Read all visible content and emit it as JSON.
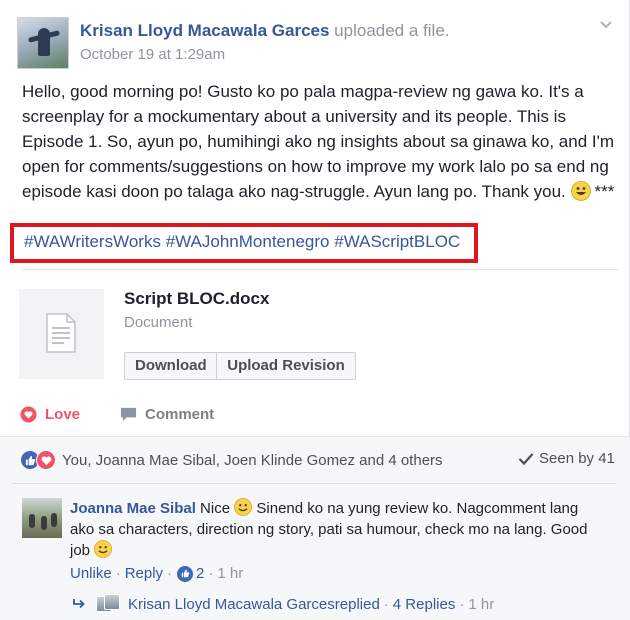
{
  "post": {
    "author": "Krisan Lloyd Macawala Garces",
    "action": " uploaded a file.",
    "timestamp": "October 19 at 1:29am",
    "text": "Hello, good morning po! Gusto ko po pala magpa-review ng gawa ko. It's a screenplay for a mockumentary about a university and its people. This is Episode 1. So, ayun po, humihingi ako ng insights about sa ginawa ko, and I'm open for comments/suggestions on how to improve my work lalo po sa end ng episode kasi doon po talaga ako nag-struggle. Ayun lang po. Thank you.",
    "text_suffix": "***",
    "hashtags": [
      "#WAWritersWorks",
      "#WAJohnMontenegro",
      "#WAScriptBLOC"
    ]
  },
  "attachment": {
    "filename": "Script BLOC.docx",
    "type": "Document",
    "download_label": "Download",
    "upload_label": "Upload Revision"
  },
  "actions": {
    "love_label": "Love",
    "comment_label": "Comment"
  },
  "reactions": {
    "summary": "You, Joanna Mae Sibal, Joen Klinde Gomez and 4 others",
    "seen": "Seen by 41"
  },
  "comment": {
    "author": "Joanna Mae Sibal",
    "text_1": " Nice ",
    "text_2": " Sinend ko na yung review ko. Nagcomment lang ako sa characters, direction ng story, pati sa humour, check mo na lang. Good job ",
    "unlike_label": "Unlike",
    "reply_label": "Reply",
    "like_count": "2",
    "time": "1 hr"
  },
  "reply_summary": {
    "author": "Krisan Lloyd Macawala Garces",
    "verb": " replied",
    "count": "4 Replies",
    "time": "1 hr"
  },
  "colors": {
    "link": "#365899",
    "love": "#f25268",
    "highlight_box": "#e0161e",
    "like_blue": "#4267b2"
  }
}
